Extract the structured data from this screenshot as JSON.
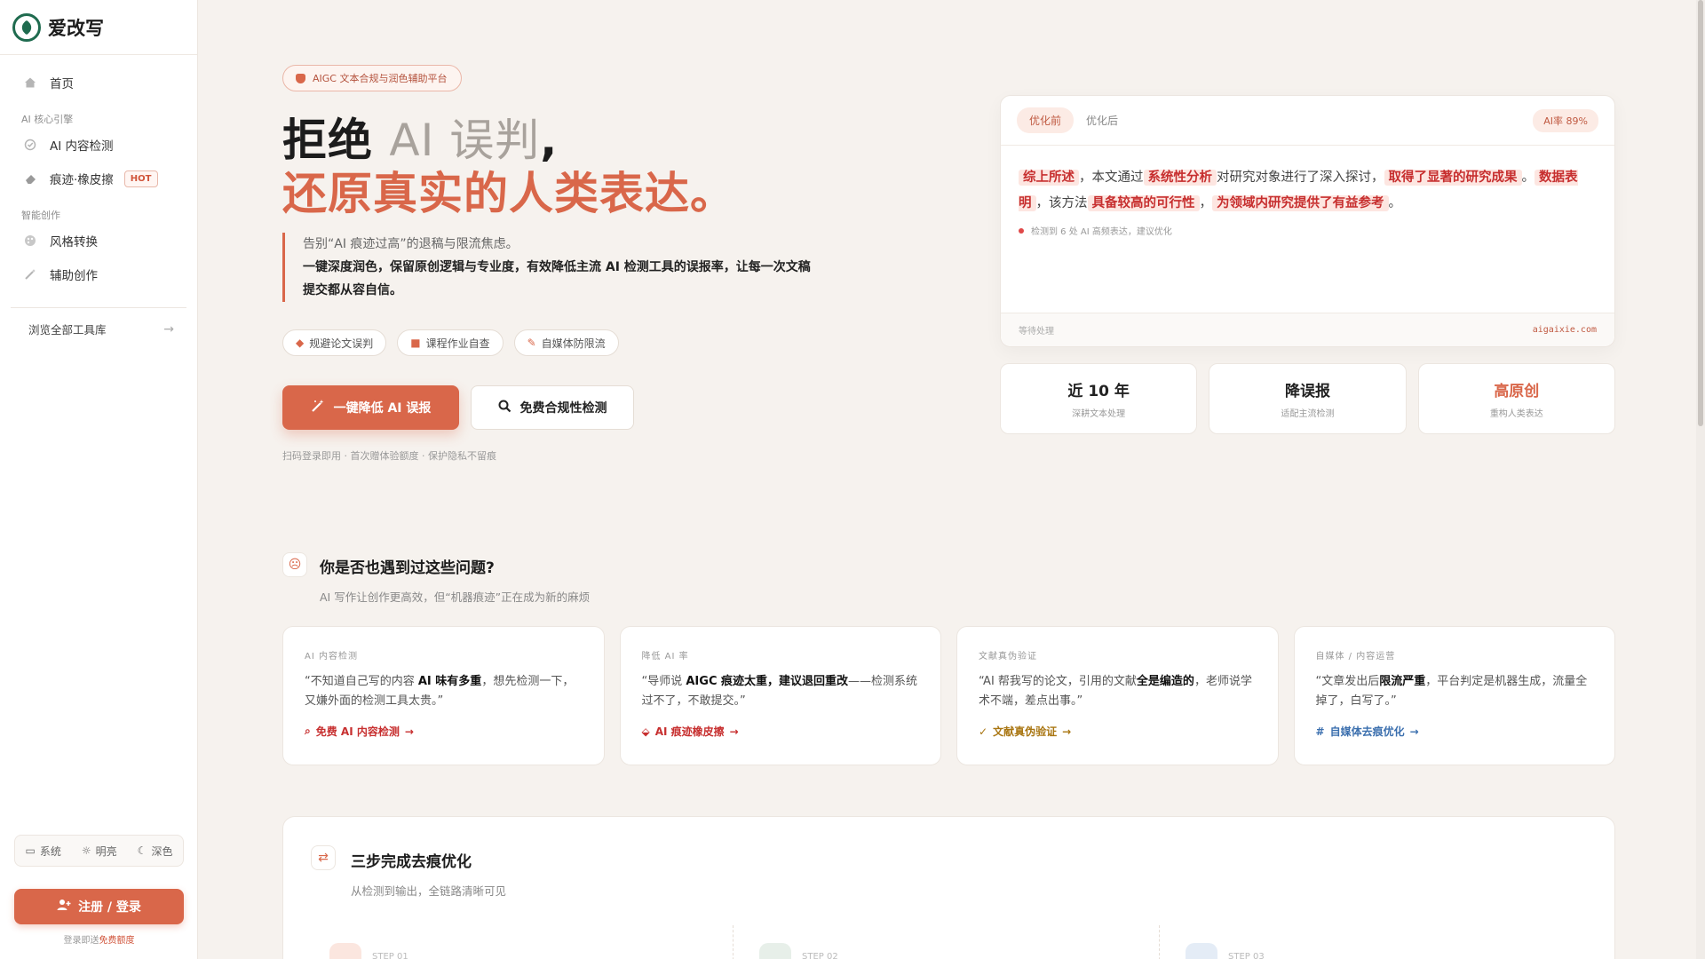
{
  "sidebar": {
    "brand": "爱改写",
    "home": "首页",
    "group1": "AI 核心引擎",
    "items1": [
      {
        "label": "AI 内容检测",
        "icon": "shield-check-icon"
      },
      {
        "label": "痕迹·橡皮擦",
        "icon": "eraser-icon",
        "badge": "HOT"
      }
    ],
    "group2": "智能创作",
    "items2": [
      {
        "label": "风格转换",
        "icon": "palette-icon"
      },
      {
        "label": "辅助创作",
        "icon": "magic-wand-icon"
      }
    ],
    "all_tools": "浏览全部工具库",
    "theme": {
      "system": "系统",
      "light": "明亮",
      "dark": "深色"
    },
    "register": "注册 / 登录",
    "register_note_prefix": "登录即送",
    "register_note_em": "免费额度"
  },
  "hero": {
    "badge": "AIGC 文本合规与润色辅助平台",
    "title_a": "拒绝",
    "title_b": "AI 误判",
    "title_c": ",",
    "title_line2": "还原真实的人类表达。",
    "desc_1": "告别“AI 痕迹过高”的退稿与限流焦虑。",
    "desc_2": "一键深度润色，保留原创逻辑与专业度，有效降低主流 AI 检测工具的误报率，让每一次文稿提交都从容自信。",
    "chips": [
      {
        "label": "规避论文误判",
        "icon": "paper-icon"
      },
      {
        "label": "课程作业自查",
        "icon": "book-icon"
      },
      {
        "label": "自媒体防限流",
        "icon": "pen-icon"
      }
    ],
    "primary_btn": "一键降低 AI 误报",
    "secondary_btn": "免费合规性检测",
    "note": "扫码登录即用 · 首次赠体验额度 · 保护隐私不留痕"
  },
  "compare": {
    "tab_before": "优化前",
    "tab_after": "优化后",
    "rate": "AI率 89%",
    "seg": [
      {
        "t": "综上所述",
        "h": true
      },
      {
        "t": "，本文通过",
        "h": false
      },
      {
        "t": "系统性分析",
        "h": true
      },
      {
        "t": "对研究对象进行了深入探讨，",
        "h": false
      },
      {
        "t": "取得了显著的研究成果",
        "h": true
      },
      {
        "t": "。",
        "h": false
      },
      {
        "t": "数据表明",
        "h": true
      },
      {
        "t": "，该方法",
        "h": false
      },
      {
        "t": "具备较高的可行性",
        "h": true
      },
      {
        "t": "，",
        "h": false
      },
      {
        "t": "为领域内研究提供了有益参考",
        "h": true
      },
      {
        "t": "。",
        "h": false
      }
    ],
    "detect": "检测到 6 处 AI 高频表达，建议优化",
    "foot_left": "等待处理",
    "foot_right": "aigaixie.com"
  },
  "stats": [
    {
      "value": "近 10 年",
      "sub": "深耕文本处理",
      "accent": false
    },
    {
      "value": "降误报",
      "sub": "适配主流检测",
      "accent": false
    },
    {
      "value": "高原创",
      "sub": "重构人类表达",
      "accent": true
    }
  ],
  "problems": {
    "title": "你是否也遇到过这些问题?",
    "subtitle": "AI 写作让创作更高效，但“机器痕迹”正在成为新的麻烦",
    "cards": [
      {
        "tag": "AI 内容检测",
        "q1": "“不知道自己写的内容 ",
        "qb": "AI 味有多重",
        "q2": "，想先检测一下，又嫌外面的检测工具太贵。”",
        "link": "免费 AI 内容检测",
        "color": "red",
        "icon": "search-icon"
      },
      {
        "tag": "降低 AI 率",
        "q1": "“导师说 ",
        "qb": "AIGC 痕迹太重，建议退回重改",
        "q2": "——检测系统过不了，不敢提交。”",
        "link": "AI 痕迹橡皮擦",
        "color": "red",
        "icon": "eraser-icon"
      },
      {
        "tag": "文献真伪验证",
        "q1": "“AI 帮我写的论文，引用的文献",
        "qb": "全是编造的",
        "q2": "，老师说学术不端，差点出事。”",
        "link": "文献真伪验证",
        "color": "gold",
        "icon": "check-icon"
      },
      {
        "tag": "自媒体 / 内容运营",
        "q1": "“文章发出后",
        "qb": "限流严重",
        "q2": "，平台判定是机器生成，流量全掉了，白写了。”",
        "link": "自媒体去痕优化",
        "color": "blue",
        "icon": "hash-icon"
      }
    ]
  },
  "steps": {
    "title": "三步完成去痕优化",
    "subtitle": "从检测到输出，全链路清晰可见",
    "labels": [
      "STEP 01",
      "STEP 02",
      "STEP 03"
    ]
  },
  "colors": {
    "accent": "#d9674a",
    "brand": "#1f6b4f",
    "highlight_text": "#c72f2f"
  }
}
